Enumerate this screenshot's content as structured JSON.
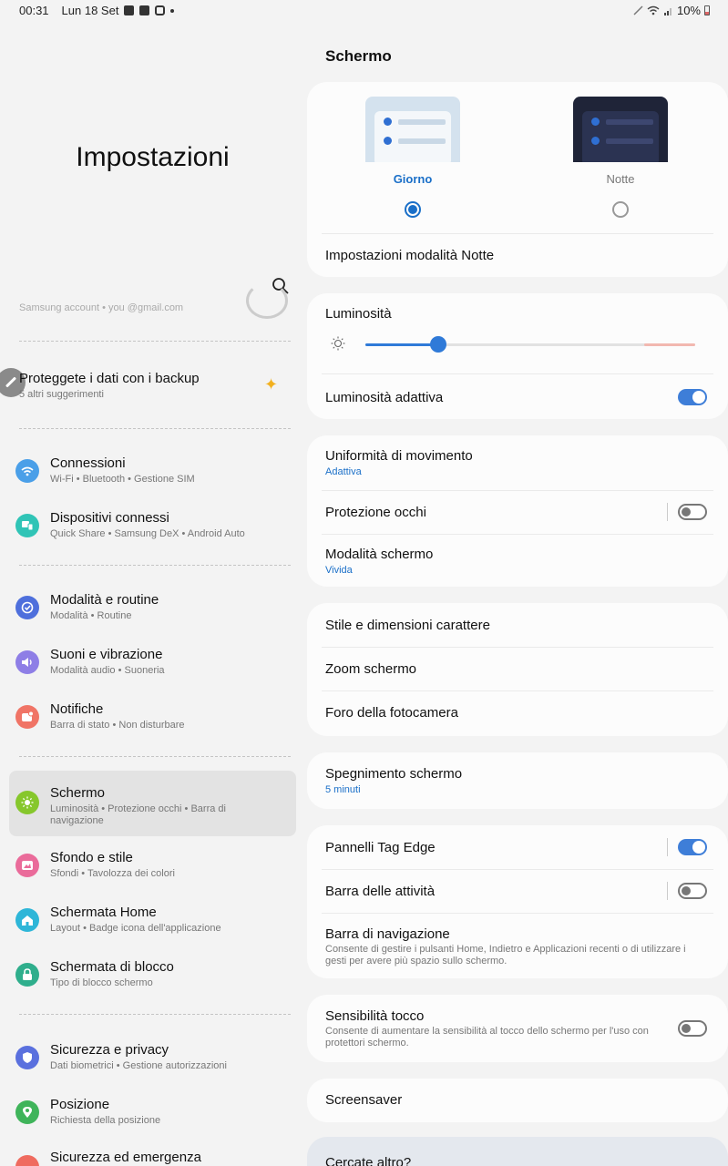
{
  "status_bar": {
    "time": "00:31",
    "date": "Lun 18 Set",
    "battery": "10%"
  },
  "left": {
    "title": "Impostazioni",
    "account_ghost": "Samsung account • you          @gmail.com",
    "suggestion": {
      "title": "Proteggete i dati con i backup",
      "subtitle": "5 altri suggerimenti"
    },
    "items": [
      {
        "title": "Connessioni",
        "subtitle": "Wi-Fi  •  Bluetooth  •  Gestione SIM",
        "icon": "wifi-icon",
        "color": "#4a9fe8"
      },
      {
        "title": "Dispositivi connessi",
        "subtitle": "Quick Share  •  Samsung DeX  •  Android Auto",
        "icon": "devices-icon",
        "color": "#30c4b6"
      },
      {
        "title": "Modalità e routine",
        "subtitle": "Modalità  •  Routine",
        "icon": "routine-icon",
        "color": "#4e6fdc"
      },
      {
        "title": "Suoni e vibrazione",
        "subtitle": "Modalità audio  •  Suoneria",
        "icon": "volume-icon",
        "color": "#8e7ee6"
      },
      {
        "title": "Notifiche",
        "subtitle": "Barra di stato  •  Non disturbare",
        "icon": "notification-icon",
        "color": "#f07466"
      },
      {
        "title": "Schermo",
        "subtitle": "Luminosità  •  Protezione occhi  •  Barra di navigazione",
        "icon": "display-icon",
        "color": "#86c72c"
      },
      {
        "title": "Sfondo e stile",
        "subtitle": "Sfondi  •  Tavolozza dei colori",
        "icon": "wallpaper-icon",
        "color": "#ea6b9a"
      },
      {
        "title": "Schermata Home",
        "subtitle": "Layout  •  Badge icona dell'applicazione",
        "icon": "home-icon",
        "color": "#2eb6d8"
      },
      {
        "title": "Schermata di blocco",
        "subtitle": "Tipo di blocco schermo",
        "icon": "lock-icon",
        "color": "#2fae8c"
      },
      {
        "title": "Sicurezza e privacy",
        "subtitle": "Dati biometrici  •  Gestione autorizzazioni",
        "icon": "shield-icon",
        "color": "#5a70de"
      },
      {
        "title": "Posizione",
        "subtitle": "Richiesta della posizione",
        "icon": "location-icon",
        "color": "#3fb45a"
      },
      {
        "title": "Sicurezza ed emergenza",
        "subtitle": "",
        "icon": "emergency-icon",
        "color": "#ef6b5f"
      }
    ]
  },
  "right": {
    "title": "Schermo",
    "theme": {
      "day": "Giorno",
      "night": "Notte",
      "night_settings": "Impostazioni modalità Notte"
    },
    "brightness": {
      "label": "Luminosità",
      "level": 0.22,
      "adaptive": "Luminosità adattiva"
    },
    "motion": {
      "label": "Uniformità di movimento",
      "value": "Adattiva"
    },
    "eye": "Protezione occhi",
    "screen_mode": {
      "label": "Modalità schermo",
      "value": "Vivida"
    },
    "font": "Stile e dimensioni carattere",
    "zoom": "Zoom schermo",
    "camera": "Foro della fotocamera",
    "timeout": {
      "label": "Spegnimento schermo",
      "value": "5 minuti"
    },
    "edge": "Pannelli Tag Edge",
    "taskbar": "Barra delle attività",
    "navbar": {
      "label": "Barra di navigazione",
      "desc": "Consente di gestire i pulsanti Home, Indietro e Applicazioni recenti o di utilizzare i gesti per avere più spazio sullo schermo."
    },
    "touch": {
      "label": "Sensibilità tocco",
      "desc": "Consente di aumentare la sensibilità al tocco dello schermo per l'uso con protettori schermo."
    },
    "screensaver": "Screensaver",
    "more": "Cercate altro?"
  }
}
